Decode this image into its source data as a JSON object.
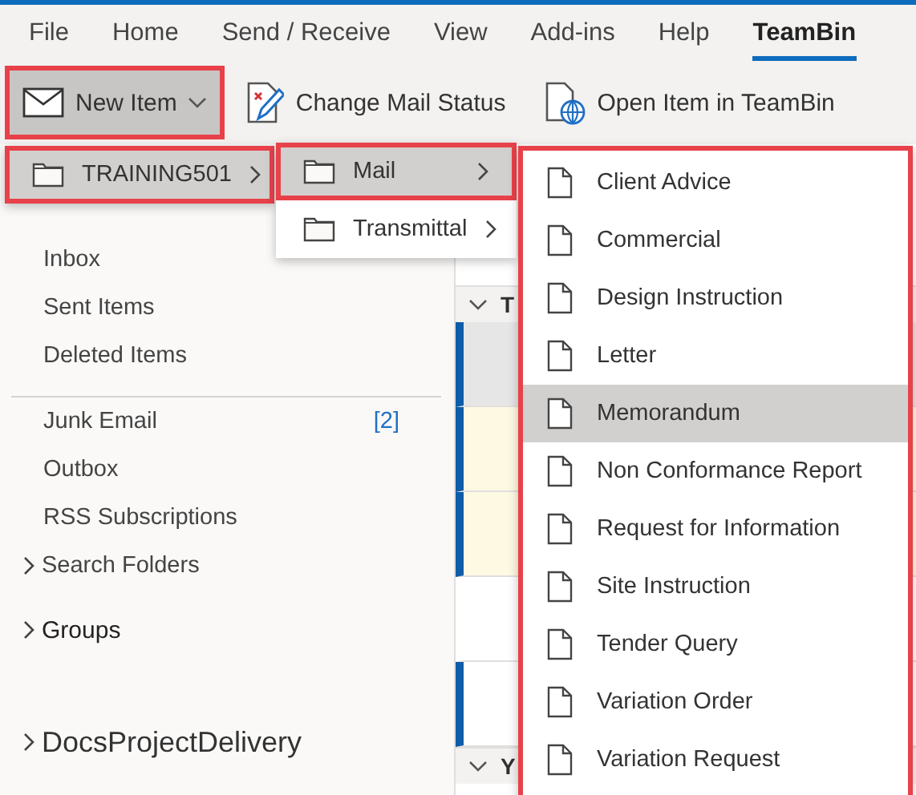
{
  "menu_tabs": [
    {
      "label": "File",
      "selected": false
    },
    {
      "label": "Home",
      "selected": false
    },
    {
      "label": "Send / Receive",
      "selected": false
    },
    {
      "label": "View",
      "selected": false
    },
    {
      "label": "Add-ins",
      "selected": false
    },
    {
      "label": "Help",
      "selected": false
    },
    {
      "label": "TeamBin",
      "selected": true
    }
  ],
  "ribbon": {
    "buttons": [
      {
        "label": "New Item",
        "kind": "mail",
        "pressed": true,
        "outlined": true,
        "dropdown": true
      },
      {
        "label": "Change Mail Status",
        "kind": "edit",
        "pressed": false,
        "outlined": false,
        "dropdown": false
      },
      {
        "label": "Open Item in TeamBin",
        "kind": "globe",
        "pressed": false,
        "outlined": false,
        "dropdown": false
      }
    ]
  },
  "nav": {
    "items": [
      {
        "label": "Inbox",
        "kind": "folder"
      },
      {
        "label": "Sent Items",
        "kind": "folder"
      },
      {
        "label": "Deleted Items",
        "kind": "folder"
      },
      {
        "label": "Junk Email",
        "kind": "folder",
        "count": "[2]",
        "divider_before": true
      },
      {
        "label": "Outbox",
        "kind": "folder"
      },
      {
        "label": "RSS Subscriptions",
        "kind": "folder"
      },
      {
        "label": "Search Folders",
        "kind": "group"
      },
      {
        "label": "Groups",
        "kind": "section"
      },
      {
        "label": "DocsProjectDelivery",
        "kind": "account"
      }
    ]
  },
  "message_list": {
    "group_headers": [
      {
        "label": "T"
      },
      {
        "label": "Y"
      }
    ],
    "rows": [
      {
        "unread": true,
        "kind": "selected"
      },
      {
        "unread": true,
        "kind": "flagged"
      },
      {
        "unread": true,
        "kind": "flagged"
      },
      {
        "unread": false,
        "kind": "plain"
      },
      {
        "unread": true,
        "kind": "plain"
      }
    ]
  },
  "menus": [
    {
      "outlined": false,
      "items": [
        {
          "label": "TRAINING501",
          "kind": "folder",
          "selected": true,
          "submenu": true,
          "outlined": true
        }
      ]
    },
    {
      "outlined": false,
      "items": [
        {
          "label": "Mail",
          "kind": "folder",
          "selected": true,
          "submenu": true,
          "outlined": true
        },
        {
          "label": "Transmittal",
          "kind": "folder",
          "selected": false,
          "submenu": true,
          "outlined": false
        }
      ]
    },
    {
      "outlined": true,
      "items": [
        {
          "label": "Client Advice",
          "kind": "document",
          "selected": false,
          "submenu": false
        },
        {
          "label": "Commercial",
          "kind": "document",
          "selected": false,
          "submenu": false
        },
        {
          "label": "Design Instruction",
          "kind": "document",
          "selected": false,
          "submenu": false
        },
        {
          "label": "Letter",
          "kind": "document",
          "selected": false,
          "submenu": false
        },
        {
          "label": "Memorandum",
          "kind": "document",
          "selected": true,
          "submenu": false
        },
        {
          "label": "Non Conformance Report",
          "kind": "document",
          "selected": false,
          "submenu": false
        },
        {
          "label": "Request for Information",
          "kind": "document",
          "selected": false,
          "submenu": false
        },
        {
          "label": "Site Instruction",
          "kind": "document",
          "selected": false,
          "submenu": false
        },
        {
          "label": "Tender Query",
          "kind": "document",
          "selected": false,
          "submenu": false
        },
        {
          "label": "Variation Order",
          "kind": "document",
          "selected": false,
          "submenu": false
        },
        {
          "label": "Variation Request",
          "kind": "document",
          "selected": false,
          "submenu": false
        }
      ]
    }
  ]
}
